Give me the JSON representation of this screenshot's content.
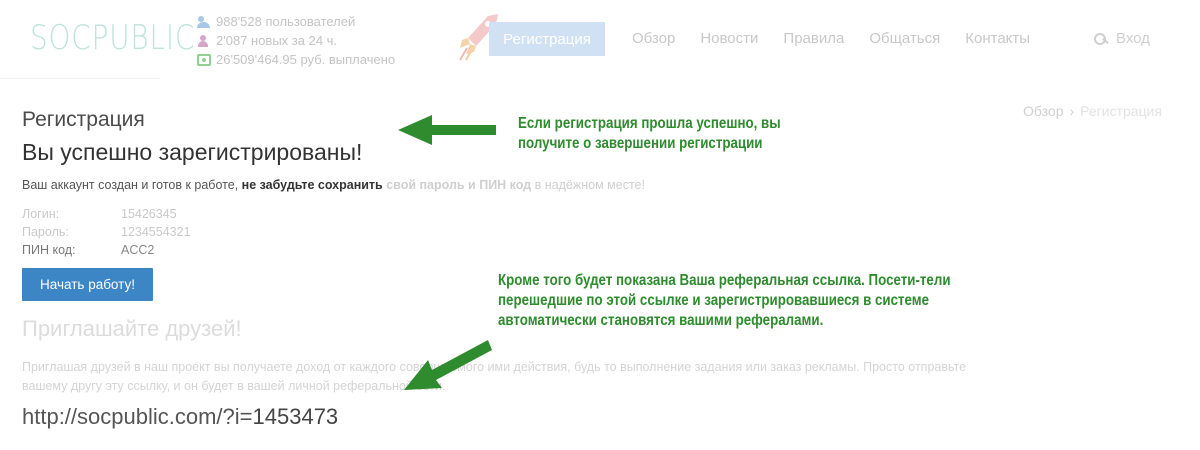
{
  "header": {
    "logo": "SOCPUBLIC",
    "stats": [
      {
        "icon": "users-icon",
        "text": "988'528 пользователей"
      },
      {
        "icon": "user-icon",
        "text": "2'087 новых за 24 ч."
      },
      {
        "icon": "money-icon",
        "text": "26'509'464.95 руб. выплачено"
      }
    ],
    "register_label": "Регистрация",
    "nav": [
      "Обзор",
      "Новости",
      "Правила",
      "Общаться",
      "Контакты"
    ],
    "login_label": "Вход"
  },
  "breadcrumb": {
    "home": "Обзор",
    "sep": "›",
    "current": "Регистрация"
  },
  "main": {
    "page_title": "Регистрация",
    "success_title": "Вы успешно зарегистрированы!",
    "account_text_start": "Ваш аккаунт создан и готов к работе,",
    "account_text_bold1": "не забудьте сохранить",
    "account_text_bold2": "свой пароль и ПИН код",
    "account_text_end": "в надёжном месте!",
    "credentials": [
      {
        "label": "Логин:",
        "value": "15426345"
      },
      {
        "label": "Пароль:",
        "value": "1234554321"
      },
      {
        "label": "ПИН код:",
        "value": "ACC2"
      }
    ],
    "start_button": "Начать работу!",
    "invite_title_start": "Приглашайте",
    "invite_title_end": "друзей!",
    "invite_text": "Приглашая друзей в наш проект вы получаете доход от каждого совершаемого ими действия, будь то выполнение задания или заказ рекламы. Просто отправьте вашему другу эту ссылку, и он будет в вашей личной реферальной сети.",
    "ref_link_base": "http://socpublic.com/?i=",
    "ref_link_id": "1453473"
  },
  "annotations": {
    "note1": "Если регистрация прошла успешно, вы получите о завершении регистрации",
    "note2": "Кроме того будет показана Ваша реферальная ссылка. Посети-тели перешедшие по этой ссылке и зарегистрировавшиеся в системе автоматически становятся вашими рефералами.",
    "color": "#2e8b2e"
  },
  "colors": {
    "primary_button": "#3d86c6",
    "logo": "#bfe3dc",
    "annotation": "#2e8b2e"
  }
}
